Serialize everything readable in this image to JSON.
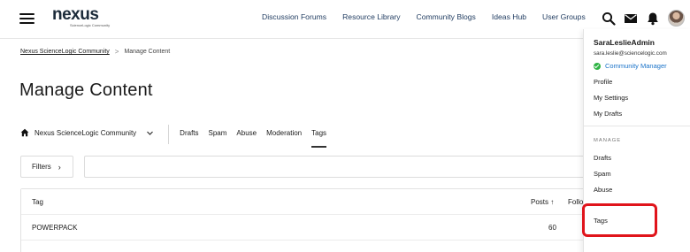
{
  "header": {
    "logo_text": "nexus",
    "logo_subtext": "ScienceLogic Community",
    "nav": [
      "Discussion Forums",
      "Resource Library",
      "Community Blogs",
      "Ideas Hub",
      "User Groups"
    ]
  },
  "breadcrumb": {
    "root": "Nexus ScienceLogic Community",
    "separator": ">",
    "current": "Manage Content"
  },
  "page": {
    "title": "Manage Content"
  },
  "tabs": {
    "community": "Nexus ScienceLogic Community",
    "items": [
      "Drafts",
      "Spam",
      "Abuse",
      "Moderation",
      "Tags"
    ],
    "active": "Tags"
  },
  "filters": {
    "label": "Filters"
  },
  "search": {
    "placeholder": ""
  },
  "table": {
    "columns": {
      "tag": "Tag",
      "posts": "Posts ↑",
      "followers": "Follo"
    },
    "rows": [
      {
        "tag": "POWERPACK",
        "posts": "60"
      }
    ]
  },
  "user_menu": {
    "username": "SaraLeslieAdmin",
    "email": "sara.leslie@sciencelogic.com",
    "role": "Community Manager",
    "items": [
      "Profile",
      "My Settings",
      "My Drafts"
    ],
    "section_label": "MANAGE",
    "manage_items": [
      "Drafts",
      "Spam",
      "Abuse",
      "Tags"
    ]
  },
  "colors": {
    "accent": "#1a73c9",
    "highlight": "#e0141b",
    "role_ok": "#2fb344"
  },
  "icons": [
    "hamburger-icon",
    "search-icon",
    "mail-icon",
    "bell-icon",
    "home-icon",
    "chevron-down-icon",
    "chevron-right-icon"
  ]
}
